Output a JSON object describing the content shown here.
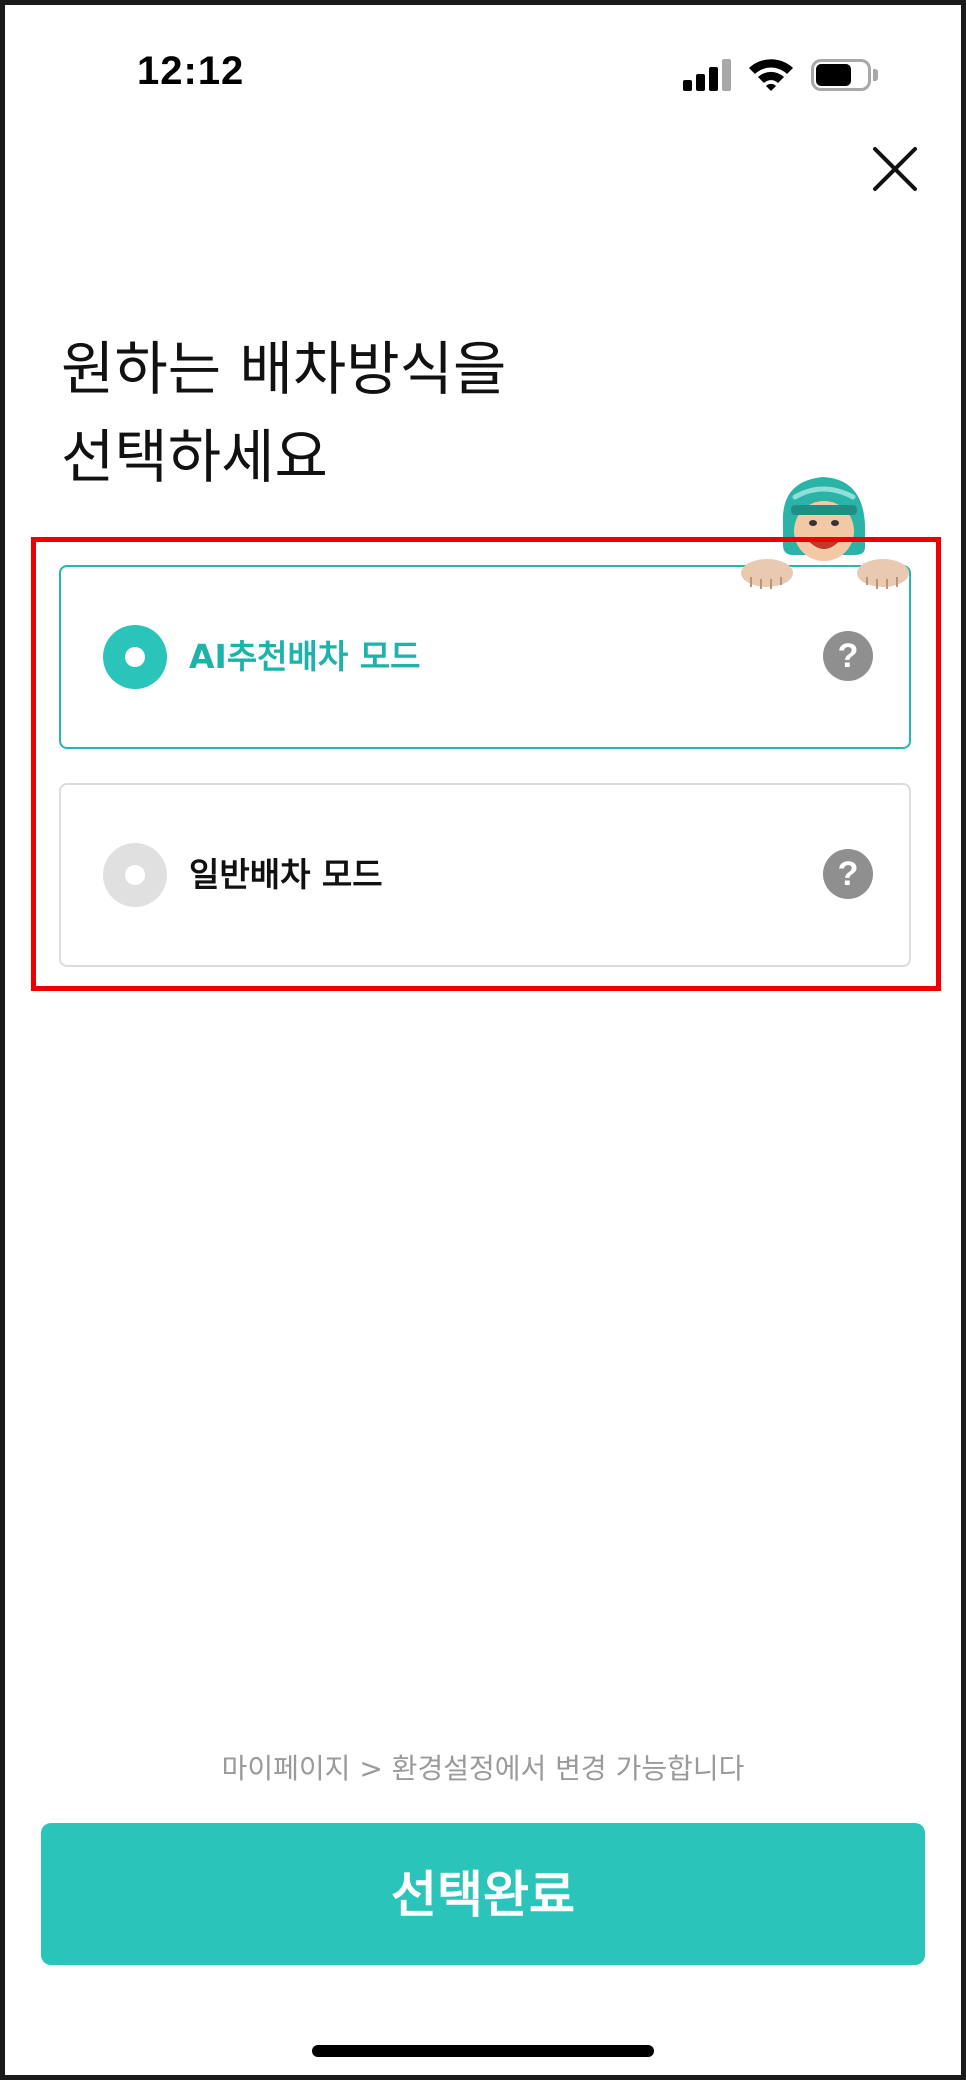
{
  "status_bar": {
    "time": "12:12",
    "battery_level": 0.7
  },
  "header": {
    "close_icon": "close-icon"
  },
  "title": "원하는 배차방식을\n선택하세요",
  "options": [
    {
      "label": "AI추천배차 모드",
      "selected": true,
      "help_label": "?"
    },
    {
      "label": "일반배차 모드",
      "selected": false,
      "help_label": "?"
    }
  ],
  "footer": {
    "note": "마이페이지 > 환경설정에서 변경 가능합니다",
    "confirm_label": "선택완료"
  },
  "colors": {
    "accent": "#2bc4bb",
    "accent_text": "#1eb3aa",
    "selected_border": "#22b8b0",
    "unselected_radio": "#e0e0e0",
    "help_icon_bg": "#8f8f8f",
    "annotation_red": "#ee0000"
  }
}
